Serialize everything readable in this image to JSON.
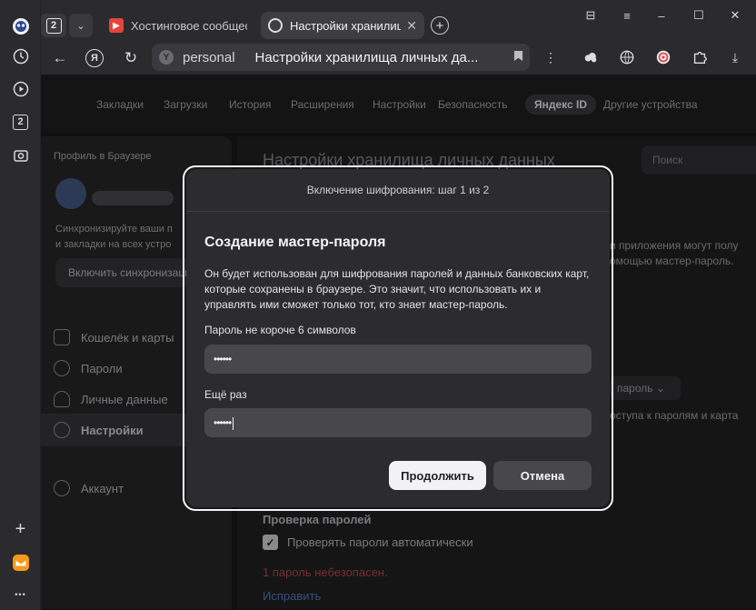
{
  "window": {
    "controls": {
      "pin": "⊟",
      "menu": "≡",
      "minimize": "–",
      "maximize": "☐",
      "close": "✕"
    }
  },
  "rail": {
    "icons": [
      "yandex-avatar-icon",
      "history-icon",
      "play-icon",
      "tabs-count-icon",
      "screenshot-icon",
      "add-icon",
      "mail-icon",
      "more-icon"
    ],
    "tabs_count": "2",
    "plus": "+",
    "more": "•••"
  },
  "tabs": {
    "count": "2",
    "menu_glyph": "⌄",
    "items": [
      {
        "title": "Хостинговое сообщество «Timeweb»",
        "favicon": "▶",
        "active": false
      },
      {
        "title": "Настройки хранилища личных данных",
        "favicon": "",
        "active": true
      }
    ],
    "close_glyph": "✕",
    "new_tab_glyph": "+"
  },
  "address": {
    "back": "←",
    "yandex": "Я",
    "reload": "↻",
    "host": "personal",
    "page_title": "Настройки хранилища личных дa...",
    "bookmark": "🔖",
    "more": "⋮",
    "download": "⤓"
  },
  "topnav": {
    "items": [
      "Закладки",
      "Загрузки",
      "История",
      "Расширения",
      "Настройки",
      "Безопасность"
    ],
    "active": "Яндекс ID",
    "other": "Другие устройства"
  },
  "sidebar": {
    "title": "Профиль в Браузере",
    "sync_text": "Синхронизируйте ваши п... и закладки на всех устрой...",
    "sync_line1": "Синхронизируйте ваши п",
    "sync_line2": "и закладки на всех устро",
    "sync_button": "Включить синхронизацию",
    "items": [
      {
        "label": "Кошелёк и карты"
      },
      {
        "label": "Пароли"
      },
      {
        "label": "Личные данные"
      },
      {
        "label": "Настройки"
      },
      {
        "label": "Аккаунт"
      }
    ]
  },
  "main": {
    "title": "Настройки хранилища личных данных",
    "search_placeholder": "Поиск",
    "bg_line1": "и приложения могут полу",
    "bg_line2": "омощью мастер-пароль.",
    "dropdown": "пароль ⌄",
    "bg_line3": "оступа к паролям и карта",
    "section": "Проверка паролей",
    "check_label": "Проверять пароли автоматически",
    "check_mark": "✓",
    "warning": "1 пароль небезопасен.",
    "fix_link": "Исправить"
  },
  "modal": {
    "header": "Включение шифрования: шаг 1 из 2",
    "title": "Создание мастер-пароля",
    "description": "Он будет использован для шифрования паролей и данных банковских карт, которые сохранены в браузере. Это значит, что использовать их и управлять ими сможет только тот, кто знает мастер-пароль.",
    "field1_label": "Пароль не короче 6 символов",
    "field1_value": "••••••",
    "field2_label": "Ещё раз",
    "field2_value": "••••••",
    "continue": "Продолжить",
    "cancel": "Отмена"
  }
}
